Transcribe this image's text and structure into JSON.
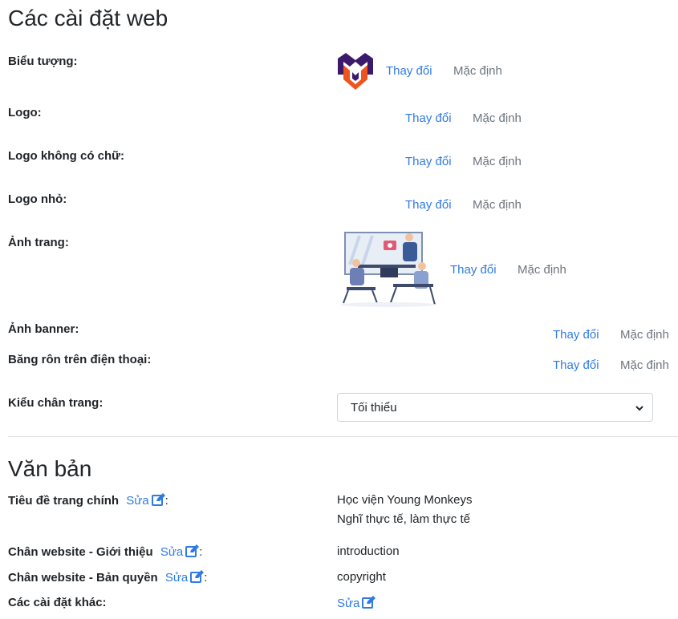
{
  "web_settings": {
    "title": "Các cài đặt web",
    "change_label": "Thay đổi",
    "default_label": "Mặc định",
    "rows": {
      "favicon": "Biểu tượng:",
      "logo": "Logo:",
      "logo_no_text": "Logo không có chữ:",
      "logo_small": "Logo nhỏ:",
      "page_image": "Ảnh trang:",
      "banner_image": "Ảnh banner:",
      "mobile_banner": "Băng rôn trên điện thoại:",
      "footer_style": "Kiểu chân trang:"
    },
    "footer_style_value": "Tối thiểu"
  },
  "text_section": {
    "title": "Văn bản",
    "edit_label": "Sửa",
    "home_title": {
      "label": "Tiêu đề trang chính",
      "line1": "Học viện Young Monkeys",
      "line2": "Nghĩ thực tế, làm thực tế"
    },
    "footer_intro": {
      "label": "Chân website - Giới thiệu",
      "value": "introduction"
    },
    "footer_copyright": {
      "label": "Chân website - Bản quyền",
      "value": "copyright"
    },
    "other_settings": {
      "label": "Các cài đặt khác:"
    }
  },
  "colors": {
    "link": "#2f7be5",
    "brand_purple": "#3b1a6b",
    "brand_orange": "#f0541e"
  }
}
